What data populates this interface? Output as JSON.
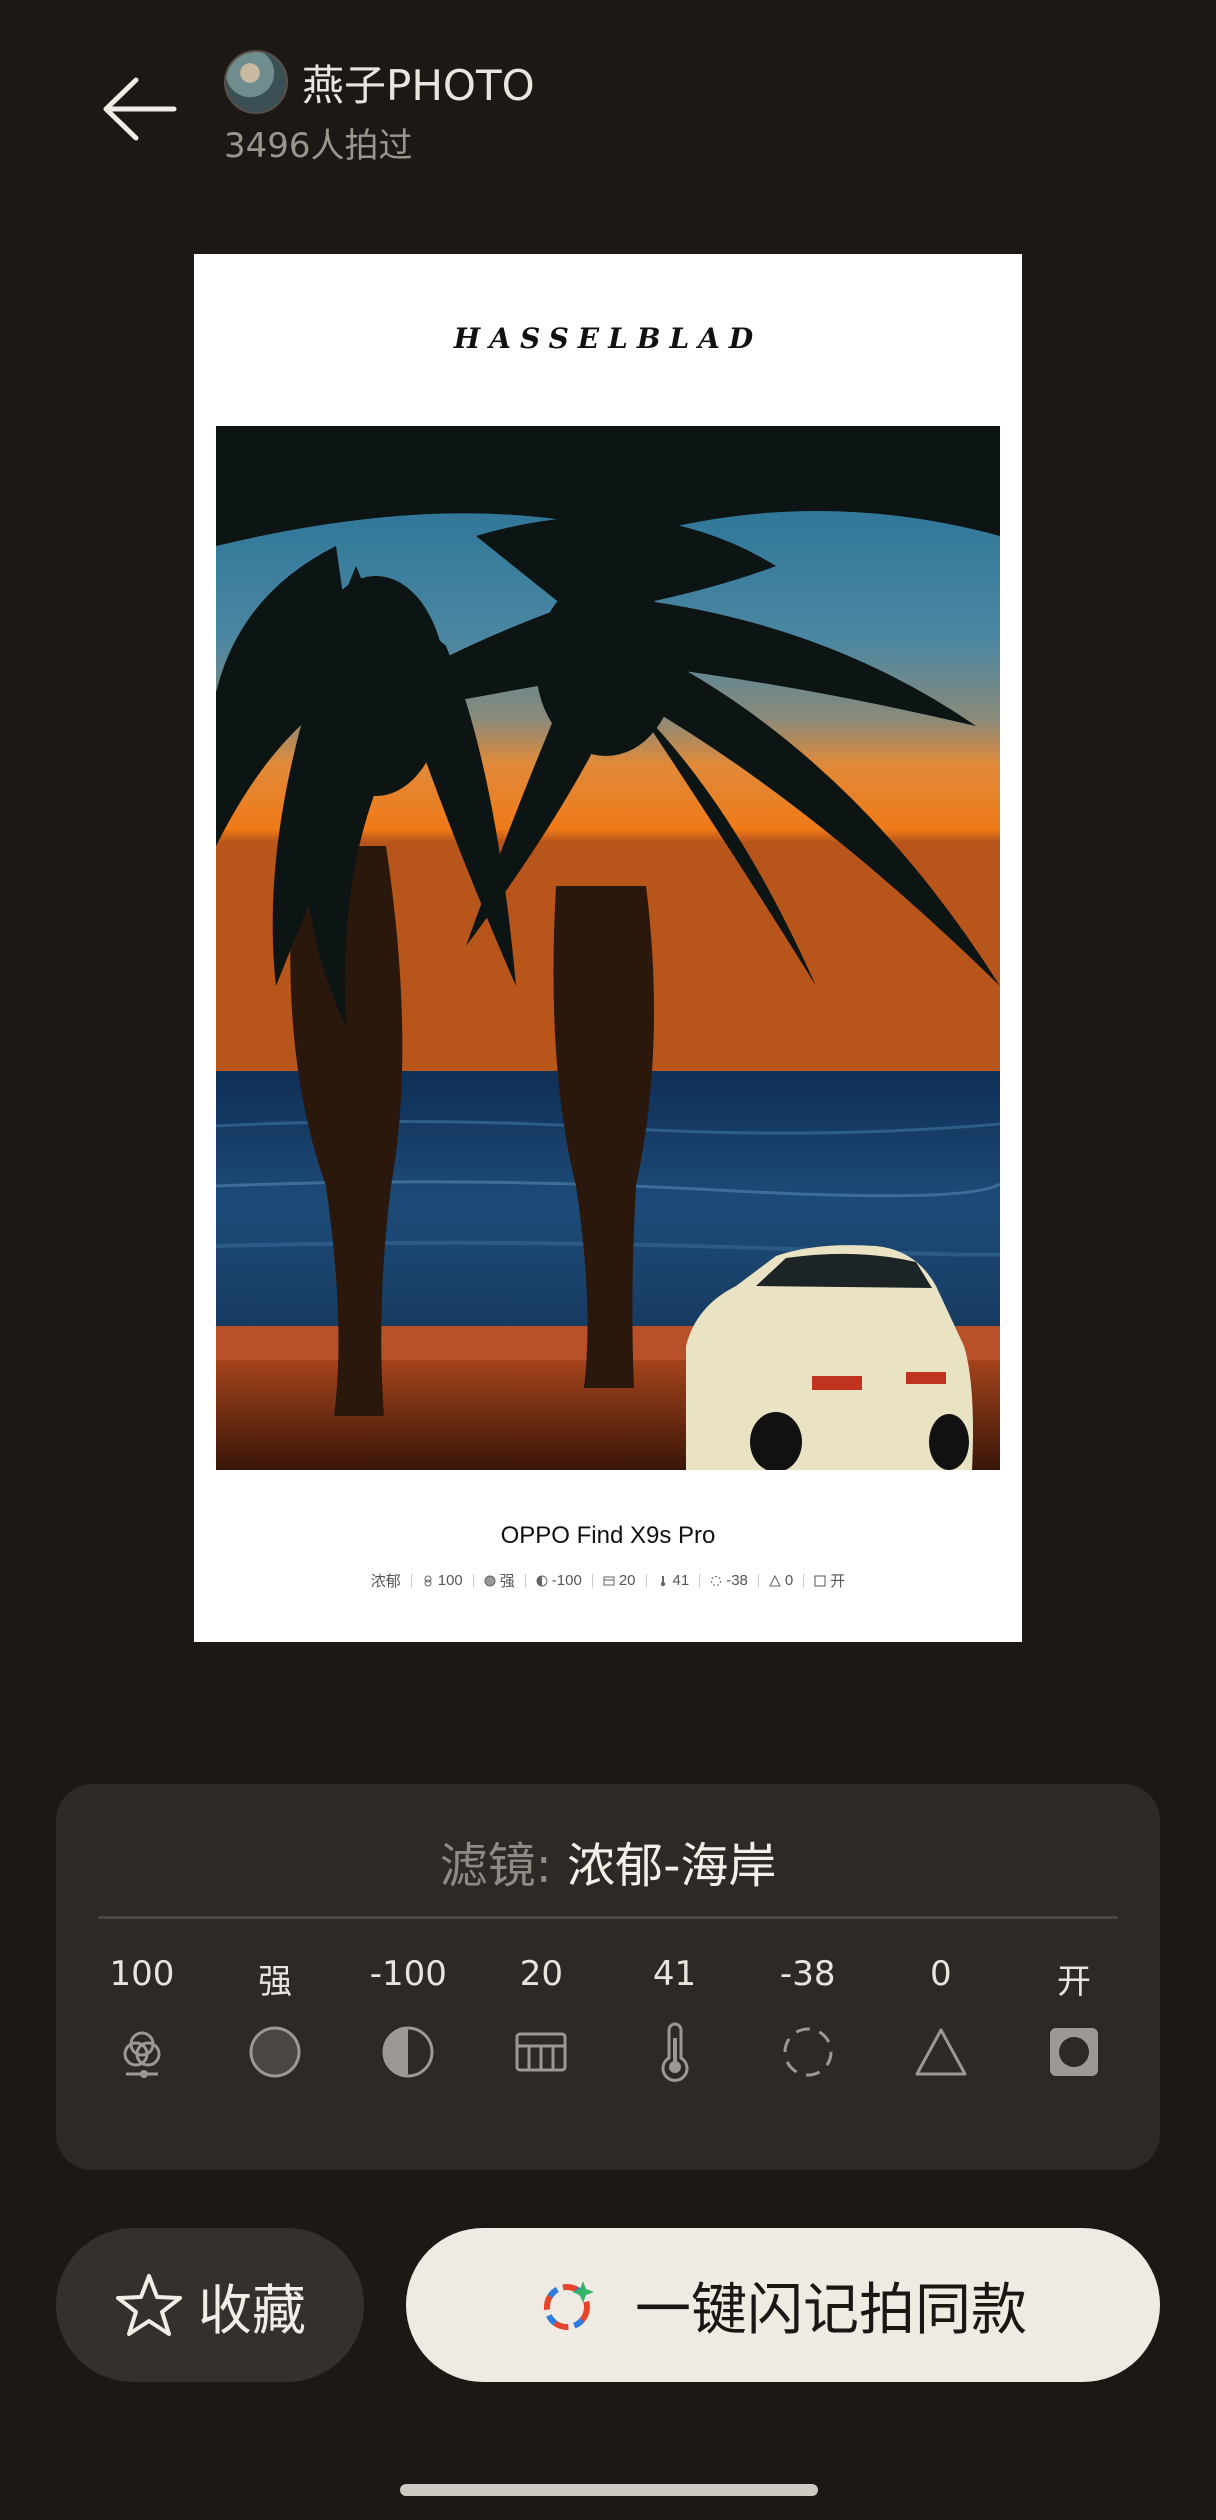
{
  "header": {
    "back_icon": "arrow-left-icon",
    "author_name": "燕子PHOTO",
    "shot_count": "3496人拍过"
  },
  "preview": {
    "brand": "HASSELBLAD",
    "model": "OPPO Find X9s Pro",
    "params": {
      "style": "浓郁",
      "p1": "100",
      "p2": "强",
      "p3": "-100",
      "p4": "20",
      "p5": "41",
      "p6": "-38",
      "p7": "0",
      "p8": "开"
    }
  },
  "filter": {
    "label": "滤镜:",
    "name": "浓郁-海岸",
    "params": [
      {
        "value": "100",
        "icon": "color-overlap-icon"
      },
      {
        "value": "强",
        "icon": "circle-icon"
      },
      {
        "value": "-100",
        "icon": "half-contrast-icon"
      },
      {
        "value": "20",
        "icon": "grid-bars-icon"
      },
      {
        "value": "41",
        "icon": "thermometer-icon"
      },
      {
        "value": "-38",
        "icon": "dotted-circle-icon"
      },
      {
        "value": "0",
        "icon": "triangle-icon"
      },
      {
        "value": "开",
        "icon": "vignette-icon"
      }
    ]
  },
  "actions": {
    "favorite_label": "收藏",
    "shoot_label": "一键闪记拍同款"
  },
  "colors": {
    "background": "#1c1816",
    "panel": "#2c2927",
    "primary_button": "#efebe3"
  }
}
